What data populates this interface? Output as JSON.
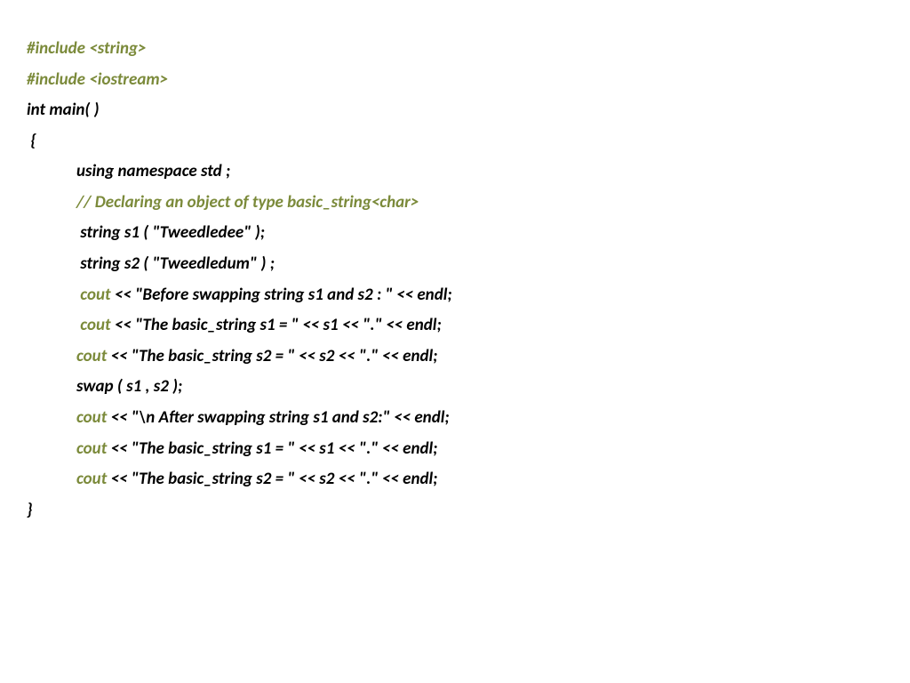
{
  "code": {
    "l1": "#include <string>",
    "l2": "#include <iostream>",
    "l3": "int main( )",
    "l4": " {",
    "l5": "using namespace std ;",
    "l6": "// Declaring an object of type basic_string<char>",
    "l7": " string s1 ( \"Tweedledee\" );",
    "l8": " string s2 ( \"Tweedledum\" ) ;",
    "l9a": " cout",
    "l9b": " << \"Before swapping string s1 and s2 : \" << endl;",
    "l10a": " cout",
    "l10b": " << \"The basic_string s1 = \" << s1 << \".\" << endl;",
    "l11a": "cout",
    "l11b": " << \"The basic_string s2 = \" << s2 << \".\" << endl;",
    "l12": "swap ( s1 , s2 );",
    "l13a": "cout",
    "l13b": " << \"\\n After swapping string s1 and s2:\" << endl;",
    "l14a": "cout",
    "l14b": " << \"The basic_string s1 = \" << s1 << \".\" << endl;",
    "l15a": "cout",
    "l15b": " << \"The basic_string s2 = \" << s2 << \".\" << endl;",
    "l16": "}"
  }
}
